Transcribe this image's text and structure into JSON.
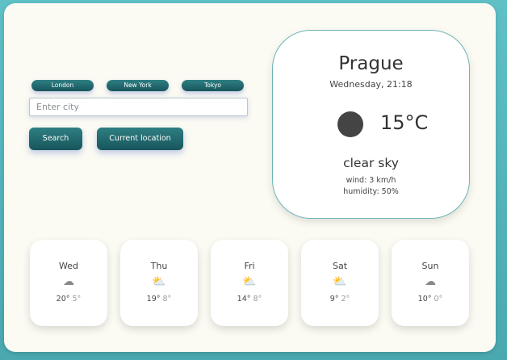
{
  "quick_cities": [
    "London",
    "New York",
    "Tokyo"
  ],
  "search": {
    "placeholder": "Enter city",
    "button_label": "Search",
    "location_label": "Current location"
  },
  "current": {
    "city": "Prague",
    "datetime": "Wednesday, 21:18",
    "icon": "dark-circle-icon",
    "temperature": "15°C",
    "description": "clear sky",
    "wind": "wind: 3 km/h",
    "humidity": "humidity: 50%"
  },
  "forecast": [
    {
      "day": "Wed",
      "icon": "cloud-icon",
      "glyph": "☁",
      "max": "20°",
      "min": "5°"
    },
    {
      "day": "Thu",
      "icon": "sun-cloud-icon",
      "glyph": "⛅",
      "max": "19°",
      "min": "8°"
    },
    {
      "day": "Fri",
      "icon": "sun-cloud-icon",
      "glyph": "⛅",
      "max": "14°",
      "min": "8°"
    },
    {
      "day": "Sat",
      "icon": "sun-cloud-icon",
      "glyph": "⛅",
      "max": "9°",
      "min": "2°"
    },
    {
      "day": "Sun",
      "icon": "cloud-icon",
      "glyph": "☁",
      "max": "10°",
      "min": "0°"
    }
  ],
  "colors": {
    "button": "#1f6a70",
    "accent_border": "#6fb4b5",
    "background": "#5fc0c6"
  }
}
